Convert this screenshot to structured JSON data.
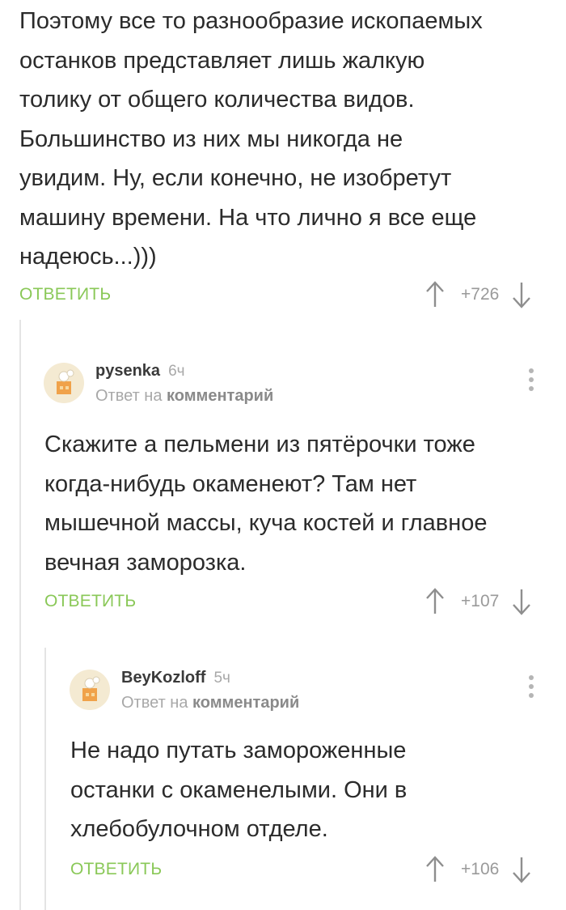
{
  "comment0": {
    "lines": [
      "Поэтому все то разнообразие ископаемых",
      "останков представляет лишь жалкую",
      "толику от общего количества видов.",
      "Большинство из них мы никогда не",
      "увидим. Ну, если конечно, не изобретут",
      "машину времени. На что лично я все еще",
      "надеюсь...)))"
    ],
    "reply_label": "ОТВЕТИТЬ",
    "rating": "+726"
  },
  "comment1": {
    "username": "pysenka",
    "time": "6ч",
    "reply_prefix": "Ответ на",
    "reply_target": "комментарий",
    "lines": [
      "Скажите а пельмени из пятёрочки тоже",
      "когда-нибудь окаменеют? Там нет",
      "мышечной массы, куча костей и главное",
      "вечная заморозка."
    ],
    "reply_label": "ОТВЕТИТЬ",
    "rating": "+107"
  },
  "comment2": {
    "username": "BeyKozloff",
    "time": "5ч",
    "reply_prefix": "Ответ на",
    "reply_target": "комментарий",
    "lines": [
      "Не надо путать замороженные",
      "останки с окаменелыми. Они в",
      "хлебобулочном отделе."
    ],
    "reply_label": "ОТВЕТИТЬ",
    "rating": "+106"
  },
  "icons": {
    "upvote": "arrow-up-icon",
    "downvote": "arrow-down-icon",
    "menu": "more-vertical-icon",
    "avatar": "default-avatar-icon"
  },
  "colors": {
    "reply": "#8ac858",
    "text": "#2b2b2b",
    "muted": "#a8a8a8"
  }
}
